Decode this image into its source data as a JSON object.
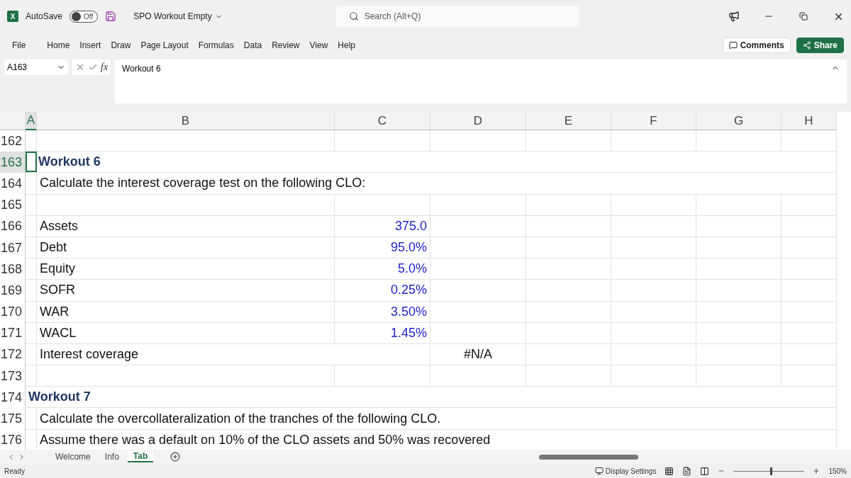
{
  "titlebar": {
    "app_icon": "X",
    "autosave_label": "AutoSave",
    "autosave": {
      "on": false,
      "label": "Off"
    },
    "document": "SPO Workout Empty",
    "search": {
      "placeholder": "Search (Alt+Q)"
    }
  },
  "menu": [
    {
      "label": "File",
      "selected": false
    },
    {
      "label": "Home",
      "selected": false
    },
    {
      "label": "Insert",
      "selected": false
    },
    {
      "label": "Draw",
      "selected": false
    },
    {
      "label": "Page Layout",
      "selected": false
    },
    {
      "label": "Formulas",
      "selected": false
    },
    {
      "label": "Data",
      "selected": false
    },
    {
      "label": "Review",
      "selected": false
    },
    {
      "label": "View",
      "selected": false
    },
    {
      "label": "Help",
      "selected": false
    }
  ],
  "actions": {
    "comments": "Comments",
    "share": "Share"
  },
  "formula_bar": {
    "name_box": "A163",
    "fx": "fx",
    "value": "Workout 6"
  },
  "columns": [
    {
      "label": "A",
      "selected": true
    },
    {
      "label": "B",
      "selected": false
    },
    {
      "label": "C",
      "selected": false
    },
    {
      "label": "D",
      "selected": false
    },
    {
      "label": "E",
      "selected": false
    },
    {
      "label": "F",
      "selected": false
    },
    {
      "label": "G",
      "selected": false
    },
    {
      "label": "H",
      "selected": false
    }
  ],
  "rows": [
    {
      "number": "162",
      "selected": false
    },
    {
      "number": "163",
      "selected": true,
      "a": "Workout 6"
    },
    {
      "number": "164",
      "selected": false,
      "b": "Calculate the interest coverage test on the following CLO:"
    },
    {
      "number": "165",
      "selected": false
    },
    {
      "number": "166",
      "selected": false,
      "b": "Assets",
      "c": "375.0"
    },
    {
      "number": "167",
      "selected": false,
      "b": "Debt",
      "c": "95.0%"
    },
    {
      "number": "168",
      "selected": false,
      "b": "Equity",
      "c": "5.0%"
    },
    {
      "number": "169",
      "selected": false,
      "b": "SOFR",
      "c": "0.25%"
    },
    {
      "number": "170",
      "selected": false,
      "b": "WAR",
      "c": "3.50%"
    },
    {
      "number": "171",
      "selected": false,
      "b": "WACL",
      "c": "1.45%"
    },
    {
      "number": "172",
      "selected": false,
      "b": "Interest coverage",
      "d": "#N/A"
    },
    {
      "number": "173",
      "selected": false
    },
    {
      "number": "174",
      "selected": false,
      "a": "Workout 7"
    },
    {
      "number": "175",
      "selected": false,
      "b": "Calculate the overcollateralization of the tranches of the following CLO."
    },
    {
      "number": "176",
      "selected": false,
      "b": "Assume there was a default on 10% of the CLO assets and 50% was recovered"
    }
  ],
  "sheets": [
    {
      "label": "Welcome",
      "selected": false
    },
    {
      "label": "Info",
      "selected": false
    },
    {
      "label": "Tab",
      "selected": true
    }
  ],
  "status_bar": {
    "mode": "Ready",
    "display_settings": "Display Settings",
    "zoom": "150%",
    "zoom_slider": {
      "level": 0.52
    }
  }
}
